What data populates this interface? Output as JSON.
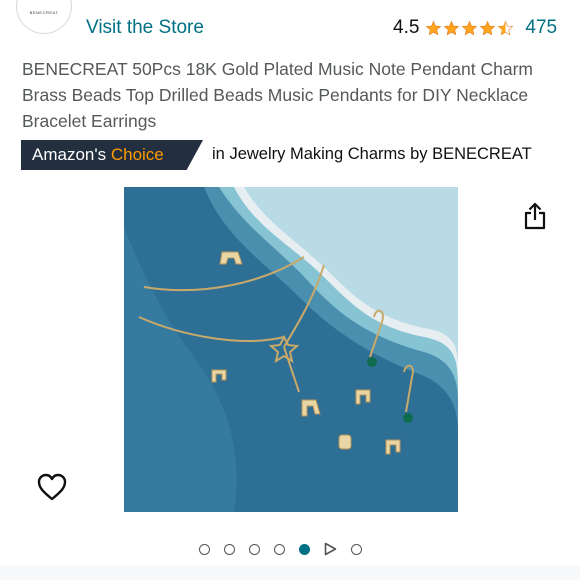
{
  "store": {
    "link_label": "Visit the Store",
    "logo_text": "BENECREAT"
  },
  "rating": {
    "value": "4.5",
    "stars": 4.5,
    "count": "475",
    "star_color": "#ffa41c"
  },
  "product": {
    "title": "BENECREAT 50Pcs 18K Gold Plated Music Note Pendant Charm Brass Beads Top Drilled Beads Music Pendants for DIY Necklace Bracelet Earrings"
  },
  "badge": {
    "label_main": "Amazon's",
    "label_accent": "Choice",
    "context_prefix": "in",
    "context_category": "Jewelry Making Charms",
    "context_suffix": "by BENECREAT",
    "bg_color": "#232f3e",
    "accent_color": "#ff9900"
  },
  "image_carousel": {
    "total": 7,
    "active_index": 4,
    "video_index": 5,
    "accent_color": "#007185"
  },
  "icons": {
    "share": "share-icon",
    "wishlist": "heart-icon"
  }
}
